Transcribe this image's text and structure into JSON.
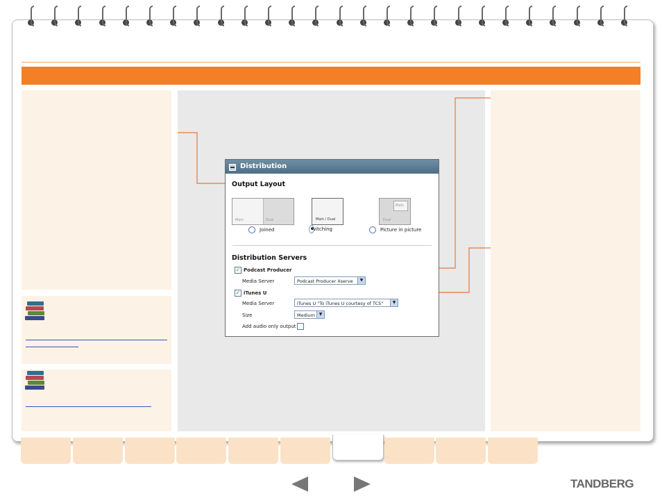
{
  "distribution": {
    "header_title": "Distribution",
    "output_layout": {
      "title": "Output Layout",
      "options": [
        {
          "label": "Joined",
          "thumb_labels": [
            "Main",
            "Dual"
          ],
          "selected": false
        },
        {
          "label": "Switching",
          "thumb_labels": [
            "Main / Dual"
          ],
          "selected": true
        },
        {
          "label": "Picture in picture",
          "thumb_labels": [
            "Main",
            "Dual"
          ],
          "selected": false
        }
      ]
    },
    "servers": {
      "title": "Distribution Servers",
      "podcast": {
        "label": "Podcast Producer",
        "checked": true,
        "media_server_label": "Media Server",
        "media_server_value": "Podcast Producer Xserve"
      },
      "itunes": {
        "label": "iTunes U",
        "checked": true,
        "media_server_label": "Media Server",
        "media_server_value": "iTunes U \"To iTunes U courtesy of TCS\"",
        "size_label": "Size",
        "size_value": "Medium",
        "audio_label": "Add audio only output",
        "audio_checked": false
      }
    }
  },
  "footer": {
    "brand": "TANDBERG",
    "prev_icon": "triangle-left-icon",
    "next_icon": "triangle-right-icon"
  },
  "colors": {
    "accent": "#f47f24",
    "panel": "#fdf2e6",
    "callout": "#e8783a",
    "link": "#3355bb"
  }
}
